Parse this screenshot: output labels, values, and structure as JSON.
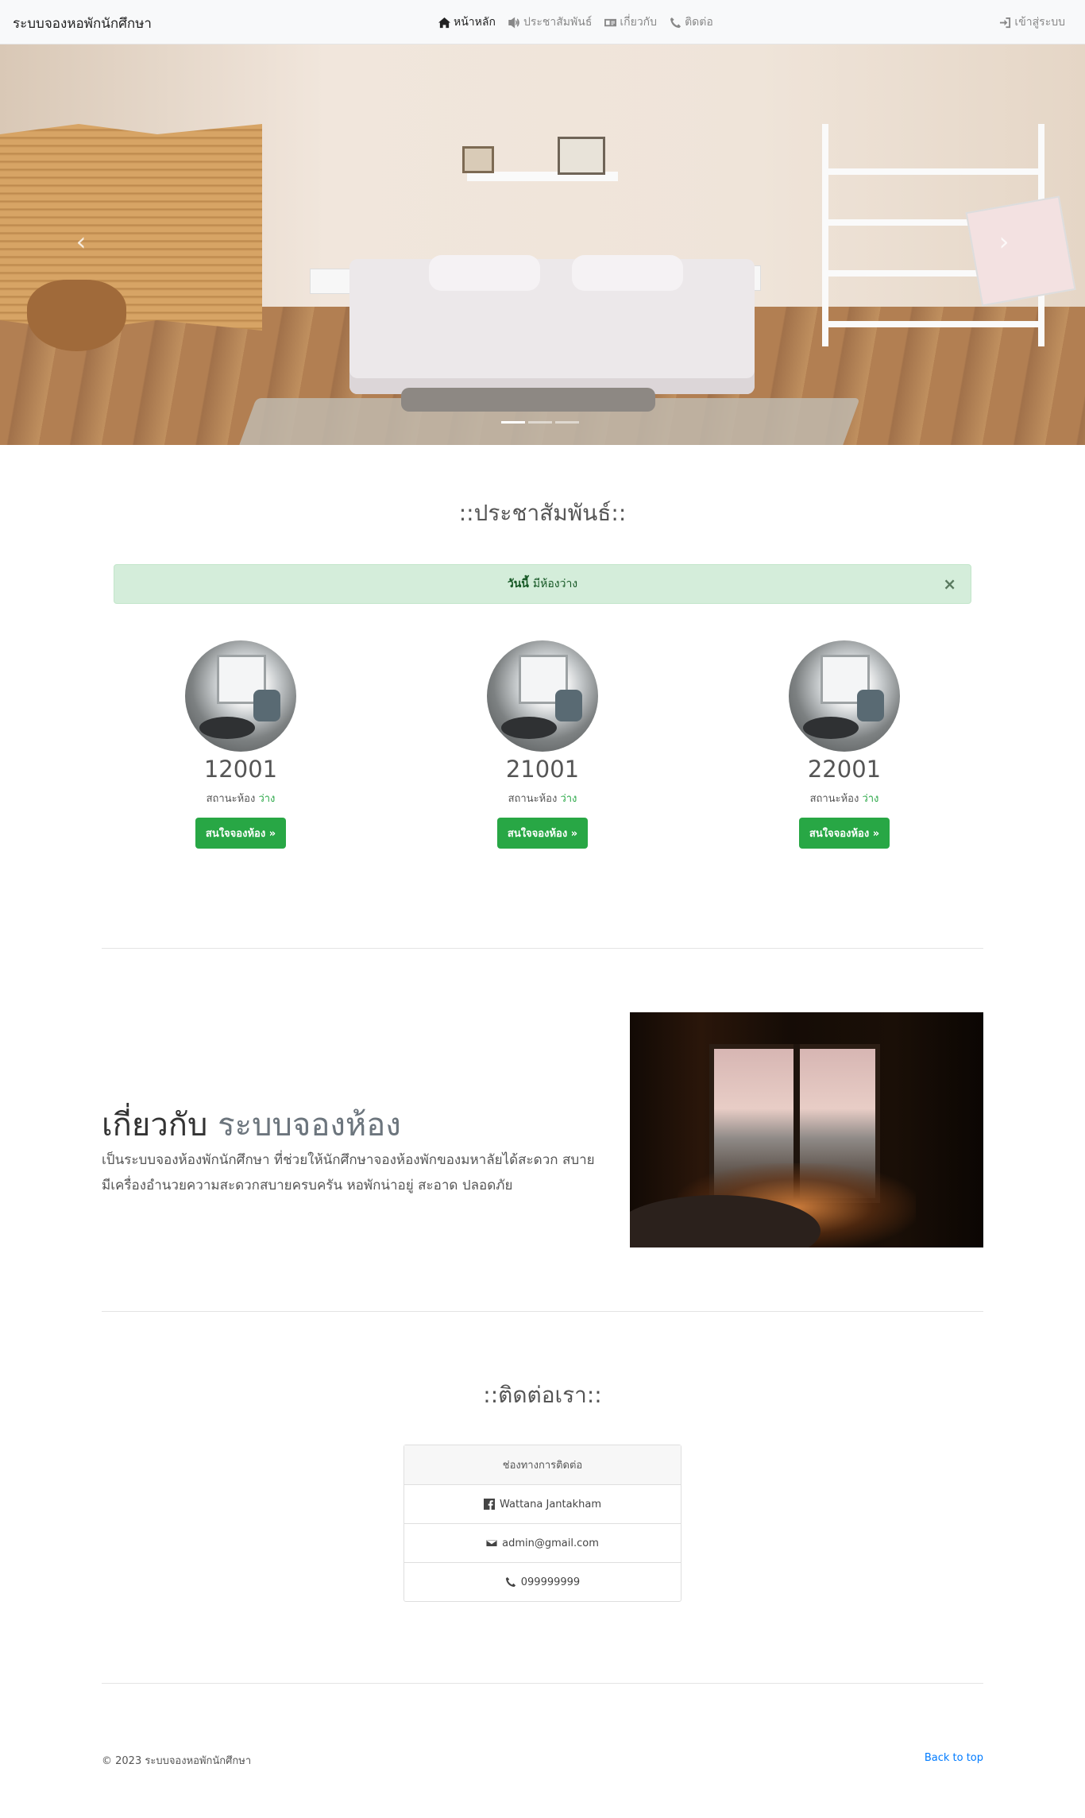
{
  "navbar": {
    "brand": "ระบบจองหอพักนักศึกษา",
    "items": [
      {
        "label": "หน้าหลัก",
        "icon": "home-icon",
        "active": true
      },
      {
        "label": "ประชาสัมพันธ์",
        "icon": "volume-icon",
        "active": false
      },
      {
        "label": "เกี่ยวกับ",
        "icon": "id-card-icon",
        "active": false
      },
      {
        "label": "ติดต่อ",
        "icon": "phone-icon",
        "active": false
      }
    ],
    "login_label": "เข้าสู่ระบบ",
    "login_icon": "sign-in-icon"
  },
  "carousel": {
    "prev_icon": "chevron-left-icon",
    "next_icon": "chevron-right-icon",
    "slide_count": 3,
    "active_slide": 1
  },
  "announcement": {
    "title": "::ประชาสัมพันธ์::",
    "alert_bold": "วันนี้",
    "alert_text": "มีห้องว่าง",
    "close_symbol": "×"
  },
  "rooms": [
    {
      "number": "12001",
      "status_label": "สถานะห้อง",
      "status": "ว่าง",
      "button": "สนใจจองห้อง »"
    },
    {
      "number": "21001",
      "status_label": "สถานะห้อง",
      "status": "ว่าง",
      "button": "สนใจจองห้อง »"
    },
    {
      "number": "22001",
      "status_label": "สถานะห้อง",
      "status": "ว่าง",
      "button": "สนใจจองห้อง »"
    }
  ],
  "about": {
    "title_main": "เกี่ยวกับ",
    "title_muted": "ระบบจองห้อง",
    "text": "เป็นระบบจองห้องพักนักศึกษา ที่ช่วยให้นักศึกษาจองห้องพักของมหาลัยได้สะดวก สบาย มีเครื่องอำนวยความสะดวกสบายครบครัน หอพักน่าอยู่ สะอาด ปลอดภัย"
  },
  "contact": {
    "title": "::ติดต่อเรา::",
    "header": "ช่องทางการติดต่อ",
    "facebook": "Wattana Jantakham",
    "email": "admin@gmail.com",
    "phone": "099999999"
  },
  "footer": {
    "copyright": "© 2023 ระบบจองหอพักนักศึกษา",
    "back_to_top": "Back to top"
  },
  "colors": {
    "success": "#28a745",
    "alert_bg": "#d4edda",
    "link": "#007bff"
  }
}
